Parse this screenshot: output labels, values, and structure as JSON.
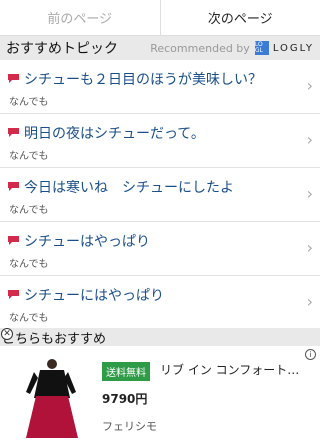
{
  "pager": {
    "prev_label": "前のページ",
    "next_label": "次のページ"
  },
  "recommend": {
    "title": "おすすめトピック",
    "powered_by": "Recommended by",
    "logo_mark": "LO GL",
    "logo_text": "LOGLY"
  },
  "topics": [
    {
      "title": "シチューも２日目のほうが美味しい？",
      "category": "なんでも"
    },
    {
      "title": "明日の夜はシチューだって。",
      "category": "なんでも"
    },
    {
      "title": "今日は寒いね　シチューにしたよ",
      "category": "なんでも"
    },
    {
      "title": "シチューはやっぱり",
      "category": "なんでも"
    },
    {
      "title": "シチューにはやっぱり",
      "category": "なんでも"
    }
  ],
  "also": {
    "title": "こちらもおすすめ"
  },
  "ad": {
    "badge": "送料無料",
    "title": "リブ イン コンフォート…",
    "price": "9790円",
    "shop": "フェリシモ"
  },
  "colors": {
    "topic_link": "#1a4f8b",
    "flag": "#d22a4a",
    "badge": "#2e9b46"
  }
}
